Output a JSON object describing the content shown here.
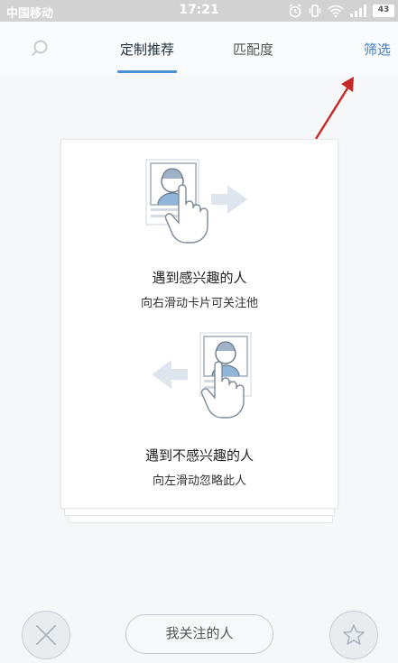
{
  "status_bar": {
    "carrier": "中国移动",
    "time": "17:21",
    "battery": "43",
    "icons": [
      "alarm-icon",
      "vibrate-icon",
      "wifi-icon",
      "signal-icon",
      "battery-icon"
    ]
  },
  "header": {
    "search_icon": "search-icon",
    "tabs": [
      {
        "label": "定制推荐",
        "active": true
      },
      {
        "label": "匹配度",
        "active": false
      }
    ],
    "filter_label": "筛选",
    "accent_color": "#4a90d9"
  },
  "card": {
    "like_title": "遇到感兴趣的人",
    "like_hint": "向右滑动卡片可关注他",
    "dislike_title": "遇到不感兴趣的人",
    "dislike_hint": "向左滑动忽略此人"
  },
  "bottom": {
    "dislike_icon": "close-icon",
    "follow_label": "我关注的人",
    "like_icon": "star-icon"
  },
  "annotation": {
    "color": "#c62828"
  }
}
